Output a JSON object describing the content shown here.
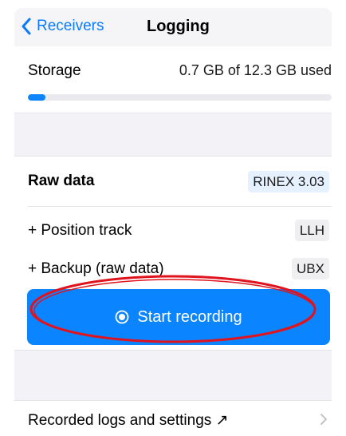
{
  "nav": {
    "back_label": "Receivers",
    "title": "Logging"
  },
  "storage": {
    "label": "Storage",
    "value": "0.7 GB of 12.3 GB used",
    "used_fraction": 0.057
  },
  "raw_data": {
    "label": "Raw data",
    "format": "RINEX 3.03"
  },
  "position_track": {
    "label": "+ Position track",
    "format": "LLH"
  },
  "backup": {
    "label": "+ Backup (raw data)",
    "format": "UBX"
  },
  "start_button": {
    "label": "Start recording"
  },
  "logs": {
    "label": "Recorded logs and settings ↗"
  },
  "colors": {
    "accent": "#0a84ff",
    "annotation": "#e0141e"
  }
}
